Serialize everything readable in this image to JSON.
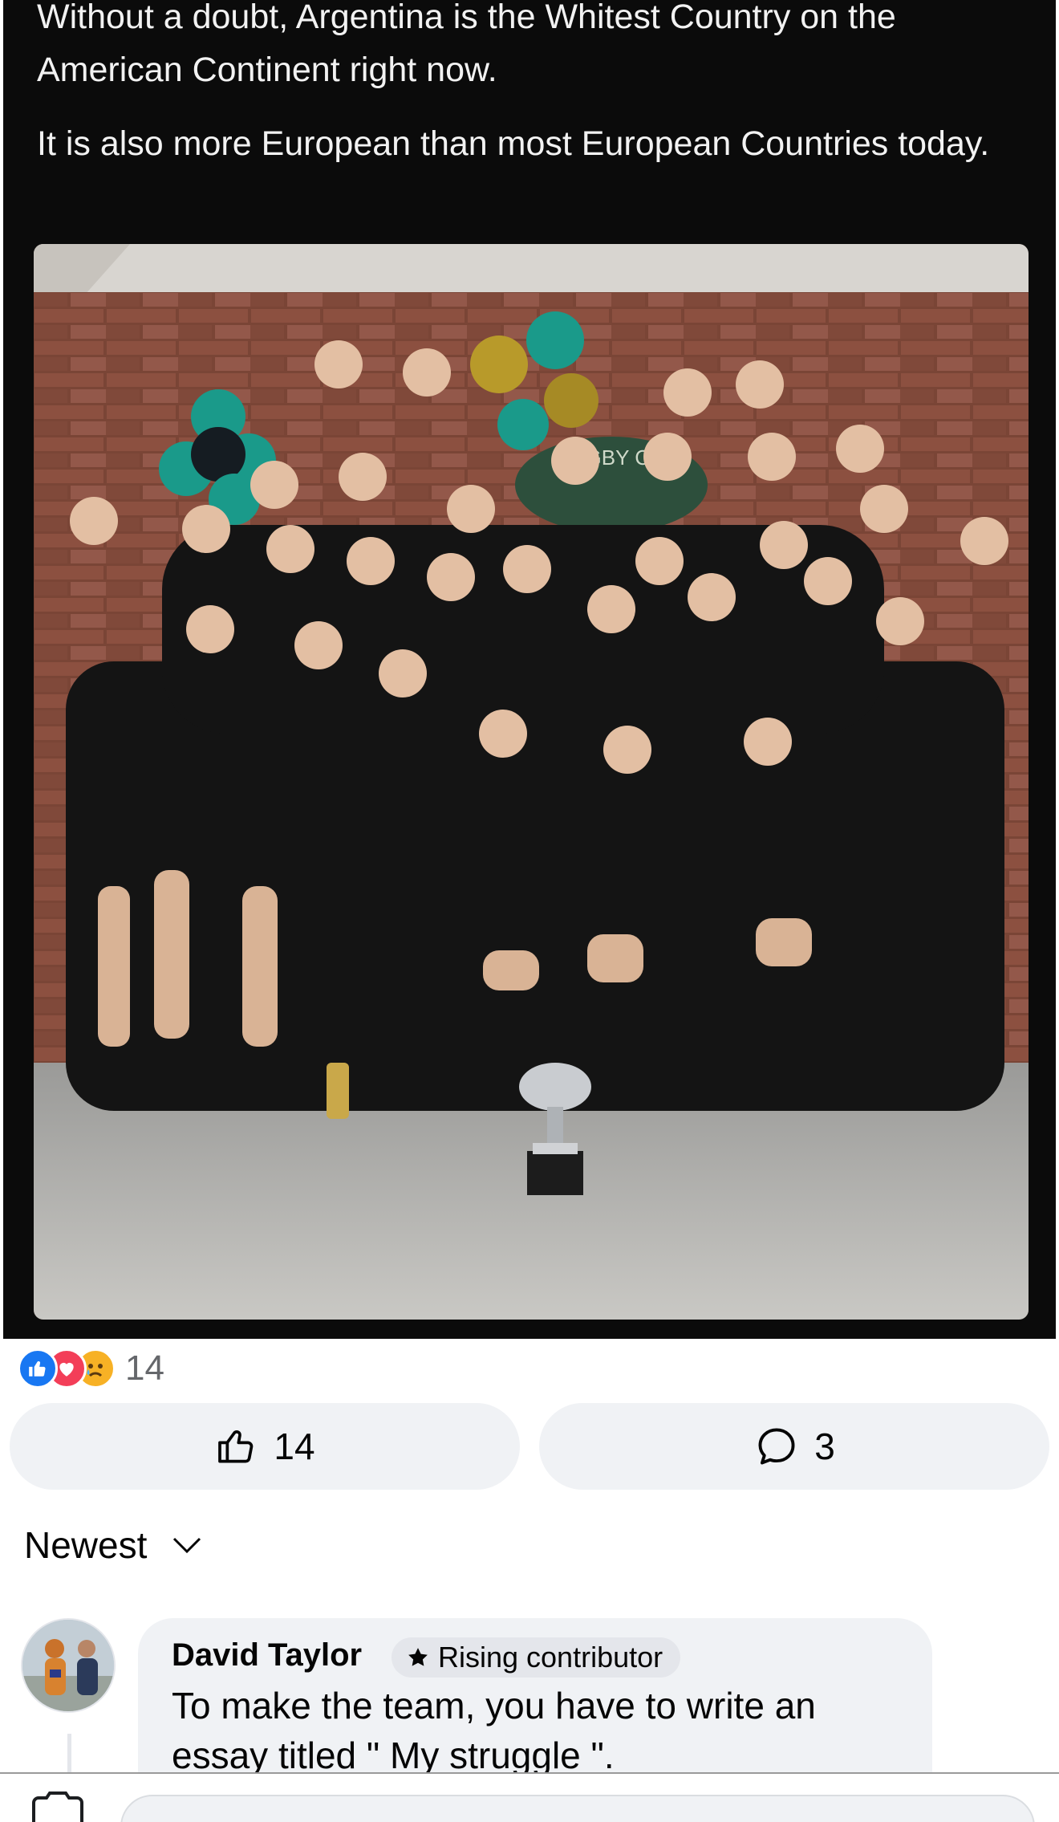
{
  "post": {
    "text_line1": "Without a doubt, Argentina is the Whitest Country on the American Continent right now.",
    "text_line2": "It is also more European than most European Countries today.",
    "photo_sign": "RUGBY CLUB"
  },
  "reactions": {
    "icons": [
      "like-icon",
      "love-icon",
      "sad-icon"
    ],
    "count": "14"
  },
  "actions": {
    "like_count": "14",
    "comment_count": "3"
  },
  "sort": {
    "label": "Newest"
  },
  "comment": {
    "author": "David Taylor",
    "badge": "Rising contributor",
    "text": "To make the team, you have to write an essay titled \" My struggle \"."
  },
  "colors": {
    "like": "#1877f2",
    "love": "#f33e58",
    "sad": "#f7b125",
    "button_bg": "#f0f2f5"
  }
}
